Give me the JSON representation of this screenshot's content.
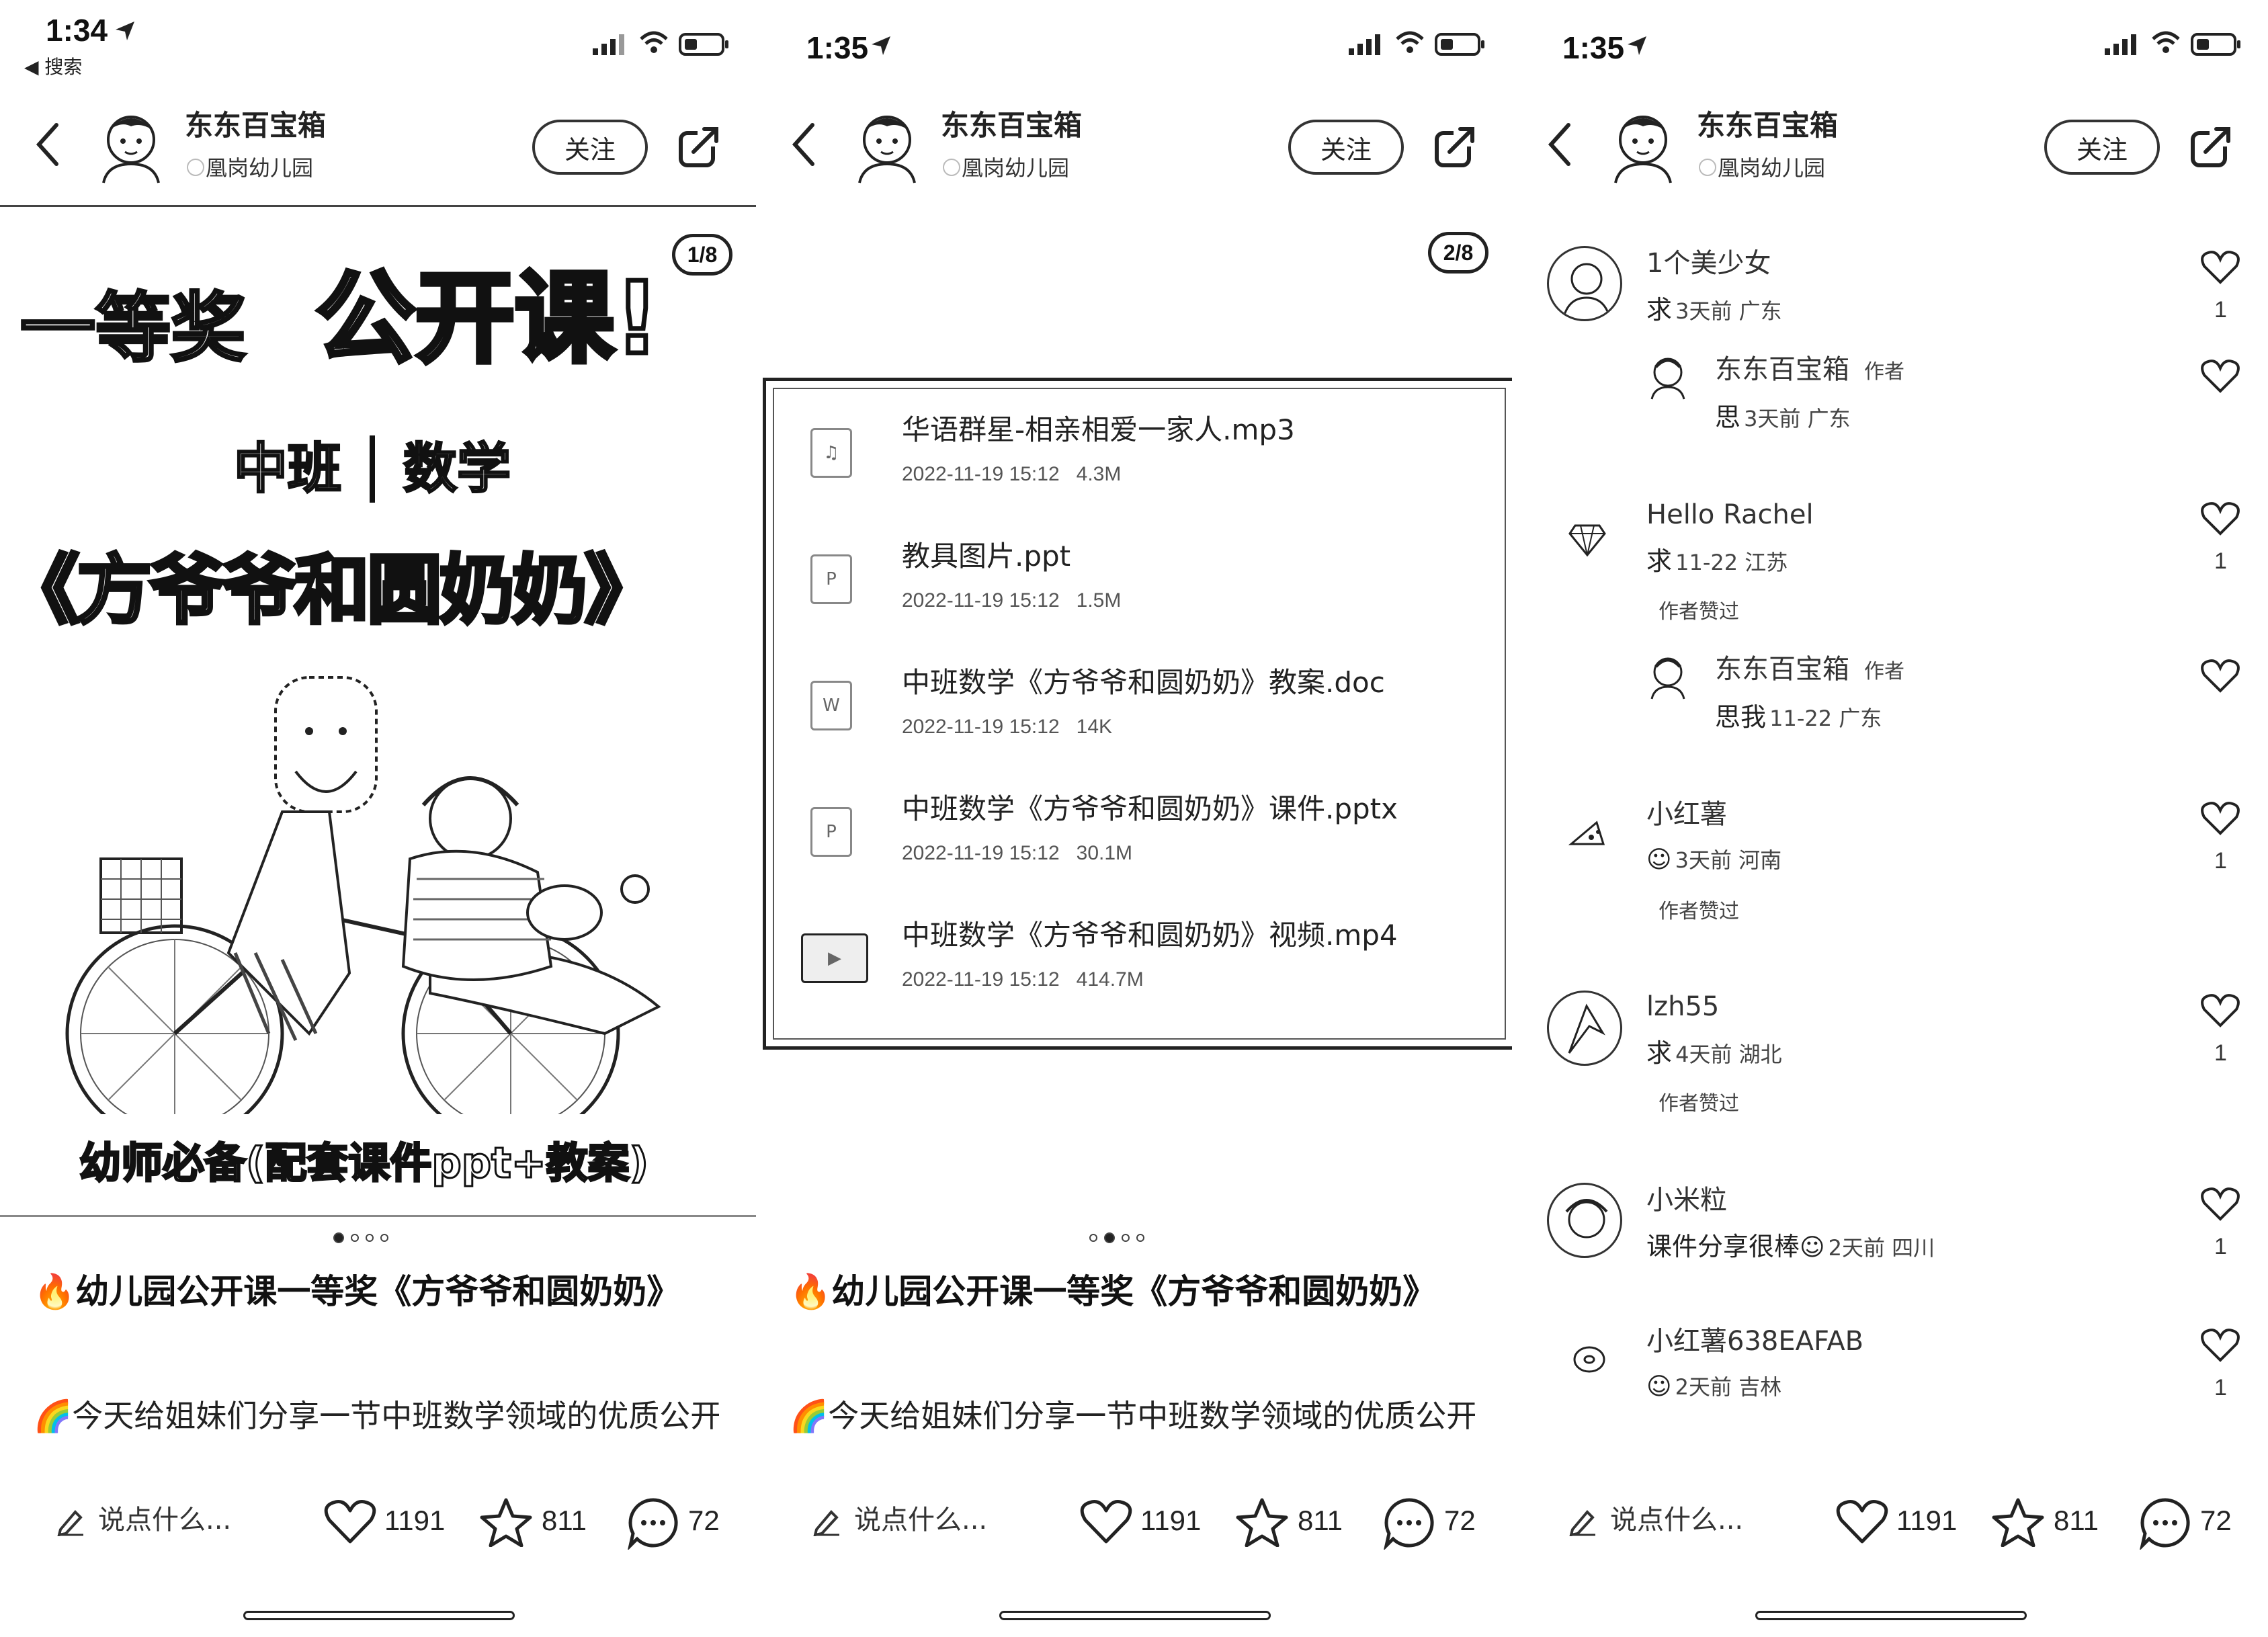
{
  "status": {
    "p1_time": "1:34",
    "p2_time": "1:35",
    "p3_time": "1:35",
    "back_label": "◀ 搜索"
  },
  "header": {
    "author_name": "东东百宝箱",
    "author_sub": "凰岗幼儿园",
    "follow_label": "关注"
  },
  "cover": {
    "page_badge": "1/8",
    "award_text": "一等奖",
    "headline": "公开课!",
    "subject_left": "中班",
    "subject_right": "数学",
    "lesson_title": "《方爷爷和圆奶奶》",
    "footer_text": "幼师必备(配套课件ppt+教案)"
  },
  "files_page": {
    "page_badge": "2/8",
    "files": [
      {
        "name": "华语群星-相亲相爱一家人.mp3",
        "date": "2022-11-19 15:12",
        "size": "4.3M",
        "icon": "audio-file-icon"
      },
      {
        "name": "教具图片.ppt",
        "date": "2022-11-19 15:12",
        "size": "1.5M",
        "icon": "ppt-file-icon"
      },
      {
        "name": "中班数学《方爷爷和圆奶奶》教案.doc",
        "date": "2022-11-19 15:12",
        "size": "14K",
        "icon": "word-file-icon"
      },
      {
        "name": "中班数学《方爷爷和圆奶奶》课件.pptx",
        "date": "2022-11-19 15:12",
        "size": "30.1M",
        "icon": "pptx-file-icon"
      },
      {
        "name": "中班数学《方爷爷和圆奶奶》视频.mp4",
        "date": "2022-11-19 15:12",
        "size": "414.7M",
        "icon": "video-thumbnail"
      }
    ]
  },
  "post": {
    "title": "幼儿园公开课一等奖《方爷爷和圆奶奶》",
    "desc": "今天给姐妹们分享一节中班数学领域的优质公开课《方爷爷和圆奶奶》"
  },
  "bottom_bar": {
    "comment_placeholder": "说点什么...",
    "likes": "1191",
    "stars": "811",
    "comments": "72"
  },
  "comments": [
    {
      "name": "1个美少女",
      "text": "求",
      "meta": "3天前 广东",
      "likes": "1",
      "reply": {
        "name": "东东百宝箱",
        "tag": "作者",
        "text": "思",
        "meta": "3天前 广东"
      }
    },
    {
      "name": "Hello Rachel",
      "text": "求",
      "meta": "11-22 江苏",
      "likes": "1",
      "badge": "作者赞过",
      "reply": {
        "name": "东东百宝箱",
        "tag": "作者",
        "text": "思我",
        "meta": "11-22 广东"
      }
    },
    {
      "name": "小红薯",
      "text": "",
      "meta": "3天前 河南",
      "likes": "1",
      "badge": "作者赞过"
    },
    {
      "name": "lzh55",
      "text": "求",
      "meta": "4天前 湖北",
      "likes": "1",
      "badge": "作者赞过"
    },
    {
      "name": "小米粒",
      "text": "课件分享很棒",
      "meta": "2天前 四川",
      "likes": "1"
    },
    {
      "name": "小红薯638EAFAB",
      "text": "",
      "meta": "2天前 吉林",
      "likes": "1"
    }
  ]
}
